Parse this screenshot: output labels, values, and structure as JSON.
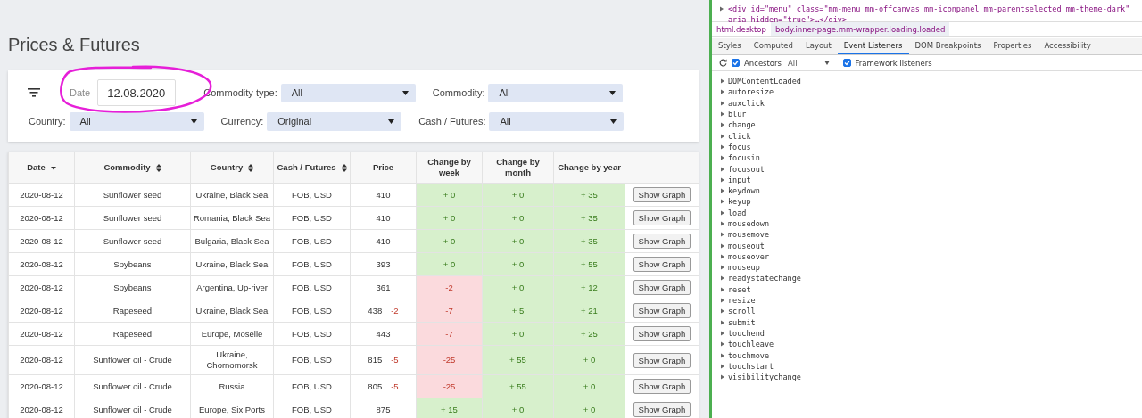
{
  "page": {
    "title": "Prices & Futures"
  },
  "filters": {
    "date": {
      "label": "Date",
      "value": "12.08.2020"
    },
    "selects_top": [
      {
        "label": "Commodity type:",
        "value": "All"
      },
      {
        "label": "Commodity:",
        "value": "All"
      }
    ],
    "selects_bottom": [
      {
        "label": "Country:",
        "value": "All"
      },
      {
        "label": "Currency:",
        "value": "Original"
      },
      {
        "label": "Cash / Futures:",
        "value": "All"
      }
    ]
  },
  "table": {
    "columns": [
      {
        "label": "Date",
        "kind": "sorted"
      },
      {
        "label": "Commodity",
        "kind": "sortable"
      },
      {
        "label": "Country",
        "kind": "sortable"
      },
      {
        "label": "Cash / Futures",
        "kind": "sortable"
      },
      {
        "label": "Price",
        "kind": "plain"
      },
      {
        "label": "Change by week",
        "kind": "plain"
      },
      {
        "label": "Change by month",
        "kind": "plain"
      },
      {
        "label": "Change by year",
        "kind": "plain"
      }
    ],
    "rows": [
      {
        "date": "2020-08-12",
        "commodity": "Sunflower seed",
        "country": "Ukraine, Black Sea",
        "basis": "FOB, USD",
        "price": "410",
        "week": {
          "text": "+ 0",
          "negative": false
        },
        "month": {
          "text": "+ 0",
          "negative": false
        },
        "year": {
          "text": "+ 35",
          "negative": false
        },
        "action": "Show Graph"
      },
      {
        "date": "2020-08-12",
        "commodity": "Sunflower seed",
        "country": "Romania, Black Sea",
        "basis": "FOB, USD",
        "price": "410",
        "week": {
          "text": "+ 0",
          "negative": false
        },
        "month": {
          "text": "+ 0",
          "negative": false
        },
        "year": {
          "text": "+ 35",
          "negative": false
        },
        "action": "Show Graph"
      },
      {
        "date": "2020-08-12",
        "commodity": "Sunflower seed",
        "country": "Bulgaria, Black Sea",
        "basis": "FOB, USD",
        "price": "410",
        "week": {
          "text": "+ 0",
          "negative": false
        },
        "month": {
          "text": "+ 0",
          "negative": false
        },
        "year": {
          "text": "+ 35",
          "negative": false
        },
        "action": "Show Graph"
      },
      {
        "date": "2020-08-12",
        "commodity": "Soybeans",
        "country": "Ukraine, Black Sea",
        "basis": "FOB, USD",
        "price": "393",
        "week": {
          "text": "+ 0",
          "negative": false
        },
        "month": {
          "text": "+ 0",
          "negative": false
        },
        "year": {
          "text": "+ 55",
          "negative": false
        },
        "action": "Show Graph"
      },
      {
        "date": "2020-08-12",
        "commodity": "Soybeans",
        "country": "Argentina, Up-river",
        "basis": "FOB, USD",
        "price": "361",
        "week": {
          "text": "-2",
          "negative": true
        },
        "month": {
          "text": "+ 0",
          "negative": false
        },
        "year": {
          "text": "+ 12",
          "negative": false
        },
        "action": "Show Graph"
      },
      {
        "date": "2020-08-12",
        "commodity": "Rapeseed",
        "country": "Ukraine, Black Sea",
        "basis": "FOB, USD",
        "price": "438",
        "price_change": "-2",
        "week": {
          "text": "-7",
          "negative": true
        },
        "month": {
          "text": "+ 5",
          "negative": false
        },
        "year": {
          "text": "+ 21",
          "negative": false
        },
        "action": "Show Graph"
      },
      {
        "date": "2020-08-12",
        "commodity": "Rapeseed",
        "country": "Europe, Moselle",
        "basis": "FOB, USD",
        "price": "443",
        "week": {
          "text": "-7",
          "negative": true
        },
        "month": {
          "text": "+ 0",
          "negative": false
        },
        "year": {
          "text": "+ 25",
          "negative": false
        },
        "action": "Show Graph"
      },
      {
        "date": "2020-08-12",
        "commodity": "Sunflower oil - Crude",
        "country": "Ukraine, Chornomorsk",
        "basis": "FOB, USD",
        "price": "815",
        "price_change": "-5",
        "week": {
          "text": "-25",
          "negative": true
        },
        "month": {
          "text": "+ 55",
          "negative": false
        },
        "year": {
          "text": "+ 0",
          "negative": false
        },
        "action": "Show Graph"
      },
      {
        "date": "2020-08-12",
        "commodity": "Sunflower oil - Crude",
        "country": "Russia",
        "basis": "FOB, USD",
        "price": "805",
        "price_change": "-5",
        "week": {
          "text": "-25",
          "negative": true
        },
        "month": {
          "text": "+ 55",
          "negative": false
        },
        "year": {
          "text": "+ 0",
          "negative": false
        },
        "action": "Show Graph"
      },
      {
        "date": "2020-08-12",
        "commodity": "Sunflower oil - Crude",
        "country": "Europe, Six Ports",
        "basis": "FOB, USD",
        "price": "875",
        "week": {
          "text": "+ 15",
          "negative": false
        },
        "month": {
          "text": "+ 0",
          "negative": false
        },
        "year": {
          "text": "+ 0",
          "negative": false
        },
        "action": "Show Graph"
      }
    ]
  },
  "devtools": {
    "code_line": "<div id=\"menu\" class=\"mm-menu mm-offcanvas mm-iconpanel mm-parentselected mm-theme-dark\" aria-hidden=\"true\">…</div>",
    "breadcrumbs": [
      {
        "label": "html.desktop",
        "selected": false
      },
      {
        "label": "body.inner-page.mm-wrapper.loading.loaded",
        "selected": true
      }
    ],
    "tabs": [
      {
        "label": "Styles",
        "selected": false
      },
      {
        "label": "Computed",
        "selected": false
      },
      {
        "label": "Layout",
        "selected": false
      },
      {
        "label": "Event Listeners",
        "selected": true
      },
      {
        "label": "DOM Breakpoints",
        "selected": false
      },
      {
        "label": "Properties",
        "selected": false
      },
      {
        "label": "Accessibility",
        "selected": false
      }
    ],
    "ancestors": {
      "label": "Ancestors",
      "checked": true
    },
    "filter_select": {
      "value": "All"
    },
    "framework": {
      "label": "Framework listeners",
      "checked": true
    },
    "events": [
      {
        "name": "DOMContentLoaded",
        "expanded": false
      },
      {
        "name": "autoresize",
        "expanded": false
      },
      {
        "name": "auxclick",
        "expanded": false
      },
      {
        "name": "blur",
        "expanded": false
      },
      {
        "name": "change",
        "expanded": false
      },
      {
        "name": "click",
        "expanded": false
      },
      {
        "name": "focus",
        "expanded": false
      },
      {
        "name": "focusin",
        "expanded": false
      },
      {
        "name": "focusout",
        "expanded": false
      },
      {
        "name": "input",
        "expanded": false
      },
      {
        "name": "keydown",
        "expanded": false
      },
      {
        "name": "keyup",
        "expanded": false
      },
      {
        "name": "load",
        "expanded": false
      },
      {
        "name": "mousedown",
        "expanded": false
      },
      {
        "name": "mousemove",
        "expanded": false
      },
      {
        "name": "mouseout",
        "expanded": false
      },
      {
        "name": "mouseover",
        "expanded": false
      },
      {
        "name": "mouseup",
        "expanded": false
      },
      {
        "name": "readystatechange",
        "expanded": false
      },
      {
        "name": "reset",
        "expanded": false
      },
      {
        "name": "resize",
        "expanded": false
      },
      {
        "name": "scroll",
        "expanded": false
      },
      {
        "name": "submit",
        "expanded": false
      },
      {
        "name": "touchend",
        "expanded": false
      },
      {
        "name": "touchleave",
        "expanded": false
      },
      {
        "name": "touchmove",
        "expanded": false
      },
      {
        "name": "touchstart",
        "expanded": false
      },
      {
        "name": "visibilitychange",
        "expanded": false
      }
    ]
  }
}
